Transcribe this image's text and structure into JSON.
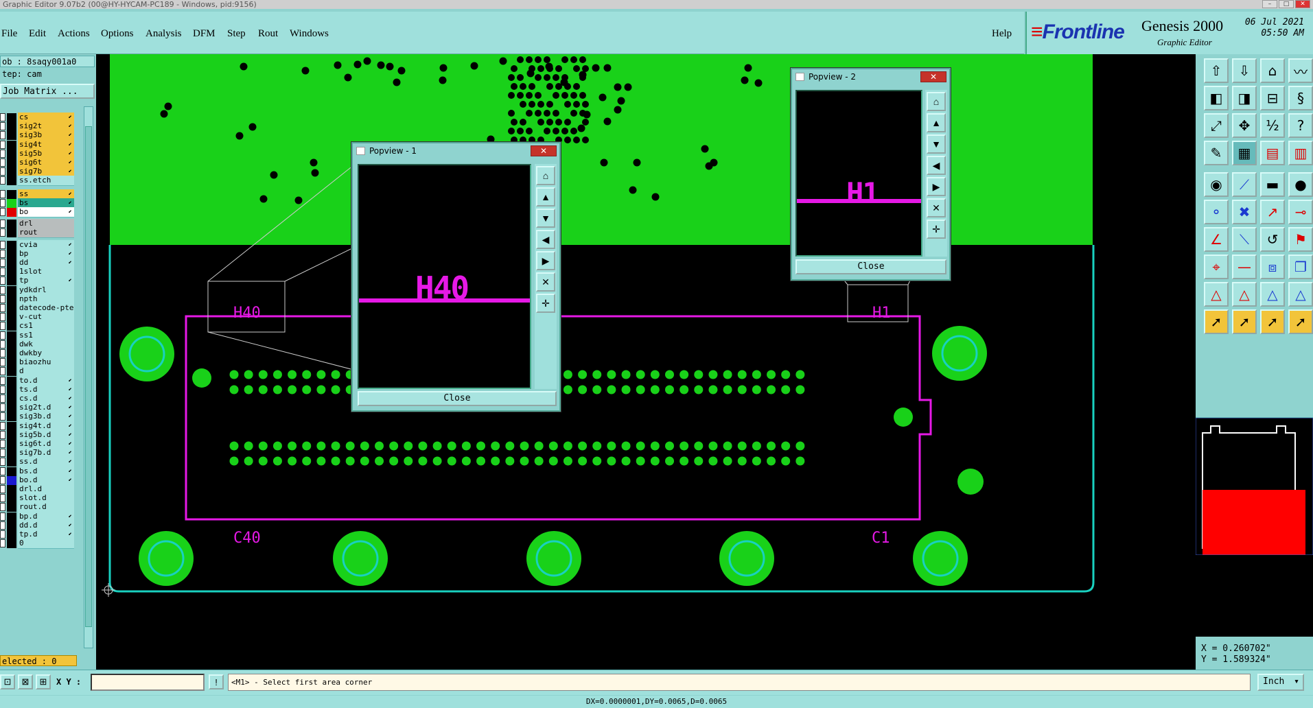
{
  "window": {
    "title": "Graphic Editor 9.07b2 (00@HY-HYCAM-PC189 - Windows, pid:9156)"
  },
  "menu": {
    "file": "File",
    "edit": "Edit",
    "actions": "Actions",
    "options": "Options",
    "analysis": "Analysis",
    "dfm": "DFM",
    "step": "Step",
    "rout": "Rout",
    "windows": "Windows",
    "help": "Help"
  },
  "brand": {
    "logo": "Frontline",
    "product": "Genesis 2000",
    "sub": "Graphic Editor",
    "date": "06 Jul 2021",
    "time": "05:50 AM"
  },
  "job": {
    "job_line": "ob : 8saqy001a0",
    "step_line": "tep: cam",
    "matrix_button": "Job Matrix ..."
  },
  "layers": [
    {
      "name": "cs",
      "color": "#000000",
      "bg": "#f2c43a",
      "arrow": true
    },
    {
      "name": "sig2t",
      "color": "#000000",
      "bg": "#f2c43a",
      "arrow": true
    },
    {
      "name": "sig3b",
      "color": "#000000",
      "bg": "#f2c43a",
      "arrow": true
    },
    {
      "name": "sig4t",
      "color": "#000000",
      "bg": "#f2c43a",
      "arrow": true
    },
    {
      "name": "sig5b",
      "color": "#000000",
      "bg": "#f2c43a",
      "arrow": true
    },
    {
      "name": "sig6t",
      "color": "#000000",
      "bg": "#f2c43a",
      "arrow": true
    },
    {
      "name": "sig7b",
      "color": "#000000",
      "bg": "#f2c43a",
      "arrow": true
    },
    {
      "name": "ss.etch",
      "color": "#000000",
      "bg": "#a8e4e0",
      "arrow": false
    },
    {
      "name": "ss",
      "color": "#000000",
      "bg": "#f2c43a",
      "arrow": true
    },
    {
      "name": "bs",
      "color": "#19d119",
      "bg": "#2aa88f",
      "arrow": true
    },
    {
      "name": "bo",
      "color": "#e00000",
      "bg": "#ffffff",
      "arrow": true
    },
    {
      "name": "drl",
      "color": "#000000",
      "bg": "#b8bdbd",
      "arrow": false
    },
    {
      "name": "rout",
      "color": "#000000",
      "bg": "#b8bdbd",
      "arrow": false
    },
    {
      "name": "cvia",
      "color": "#000000",
      "bg": "#a8e4e0",
      "arrow": true
    },
    {
      "name": "bp",
      "color": "#000000",
      "bg": "#a8e4e0",
      "arrow": true
    },
    {
      "name": "dd",
      "color": "#000000",
      "bg": "#a8e4e0",
      "arrow": true
    },
    {
      "name": "1slot",
      "color": "#000000",
      "bg": "#a8e4e0",
      "arrow": false
    },
    {
      "name": "tp",
      "color": "#000000",
      "bg": "#a8e4e0",
      "arrow": true
    },
    {
      "name": "ydkdrl",
      "color": "#000000",
      "bg": "#a8e4e0",
      "arrow": false
    },
    {
      "name": "npth",
      "color": "#000000",
      "bg": "#a8e4e0",
      "arrow": false
    },
    {
      "name": "datecode-pte",
      "color": "#000000",
      "bg": "#a8e4e0",
      "arrow": false
    },
    {
      "name": "v-cut",
      "color": "#000000",
      "bg": "#a8e4e0",
      "arrow": false
    },
    {
      "name": "cs1",
      "color": "#000000",
      "bg": "#a8e4e0",
      "arrow": false
    },
    {
      "name": "ss1",
      "color": "#000000",
      "bg": "#a8e4e0",
      "arrow": false
    },
    {
      "name": "dwk",
      "color": "#000000",
      "bg": "#a8e4e0",
      "arrow": false
    },
    {
      "name": "dwkby",
      "color": "#000000",
      "bg": "#a8e4e0",
      "arrow": false
    },
    {
      "name": "biaozhu",
      "color": "#000000",
      "bg": "#a8e4e0",
      "arrow": false
    },
    {
      "name": "d",
      "color": "#000000",
      "bg": "#a8e4e0",
      "arrow": false
    },
    {
      "name": "to.d",
      "color": "#000000",
      "bg": "#a8e4e0",
      "arrow": true
    },
    {
      "name": "ts.d",
      "color": "#000000",
      "bg": "#a8e4e0",
      "arrow": true
    },
    {
      "name": "cs.d",
      "color": "#000000",
      "bg": "#a8e4e0",
      "arrow": true
    },
    {
      "name": "sig2t.d",
      "color": "#000000",
      "bg": "#a8e4e0",
      "arrow": true
    },
    {
      "name": "sig3b.d",
      "color": "#000000",
      "bg": "#a8e4e0",
      "arrow": true
    },
    {
      "name": "sig4t.d",
      "color": "#000000",
      "bg": "#a8e4e0",
      "arrow": true
    },
    {
      "name": "sig5b.d",
      "color": "#000000",
      "bg": "#a8e4e0",
      "arrow": true
    },
    {
      "name": "sig6t.d",
      "color": "#000000",
      "bg": "#a8e4e0",
      "arrow": true
    },
    {
      "name": "sig7b.d",
      "color": "#000000",
      "bg": "#a8e4e0",
      "arrow": true
    },
    {
      "name": "ss.d",
      "color": "#000000",
      "bg": "#a8e4e0",
      "arrow": true
    },
    {
      "name": "bs.d",
      "color": "#000000",
      "bg": "#a8e4e0",
      "arrow": true
    },
    {
      "name": "bo.d",
      "color": "#1a1ad0",
      "bg": "#a8e4e0",
      "arrow": true
    },
    {
      "name": "drl.d",
      "color": "#000000",
      "bg": "#a8e4e0",
      "arrow": false
    },
    {
      "name": "slot.d",
      "color": "#000000",
      "bg": "#a8e4e0",
      "arrow": false
    },
    {
      "name": "rout.d",
      "color": "#000000",
      "bg": "#a8e4e0",
      "arrow": false
    },
    {
      "name": "bp.d",
      "color": "#000000",
      "bg": "#a8e4e0",
      "arrow": true
    },
    {
      "name": "dd.d",
      "color": "#000000",
      "bg": "#a8e4e0",
      "arrow": true
    },
    {
      "name": "tp.d",
      "color": "#000000",
      "bg": "#a8e4e0",
      "arrow": true
    },
    {
      "name": "0",
      "color": "#000000",
      "bg": "#a8e4e0",
      "arrow": false
    }
  ],
  "selected": "elected : 0",
  "canvas": {
    "labels": {
      "h40": "H40",
      "h1": "H1",
      "c40": "C40",
      "c1": "C1"
    },
    "colors": {
      "copper": "#19d119",
      "silk": "#e619e6",
      "outline": "#19d1c0"
    }
  },
  "popview1": {
    "title": "Popview - 1",
    "text": "H40",
    "close": "Close"
  },
  "popview2": {
    "title": "Popview - 2",
    "text": "H1",
    "close": "Close"
  },
  "status": {
    "xy_label": "X Y :",
    "xy_value": "",
    "message": "<M1> - Select first area corner",
    "unit": "Inch",
    "delta": "DX=0.0000001,DY=0.0065,D=0.0065"
  },
  "coords": {
    "x": "X = 0.260702\"",
    "y": "Y = 1.589324\""
  },
  "tool_icons": [
    "home-up-icon",
    "home-down-icon",
    "home-icon",
    "wave-icon",
    "swap-left-icon",
    "swap-right-icon",
    "split-icon",
    "s-curve-icon",
    "zoom-fit-icon",
    "zoom-in-icon",
    "scale-1-2-icon",
    "help-icon",
    "mouse-icon",
    "grid-icon",
    "layers-red-icon",
    "layers-icon",
    "target-icon",
    "measure-icon",
    "ruler-icon",
    "circle-icon",
    "node-icon",
    "pad-icon",
    "route-icon",
    "connect-icon",
    "angle-icon",
    "line-icon",
    "arc-icon",
    "flag-icon",
    "snap-icon",
    "dash-icon",
    "frame-icon",
    "copy-icon",
    "triangle-icon",
    "triangle2-icon",
    "triangle3-icon",
    "triangle4-icon",
    "pointer-icon",
    "pointer-select-icon",
    "pointer-area-icon",
    "pointer-multi-icon"
  ]
}
